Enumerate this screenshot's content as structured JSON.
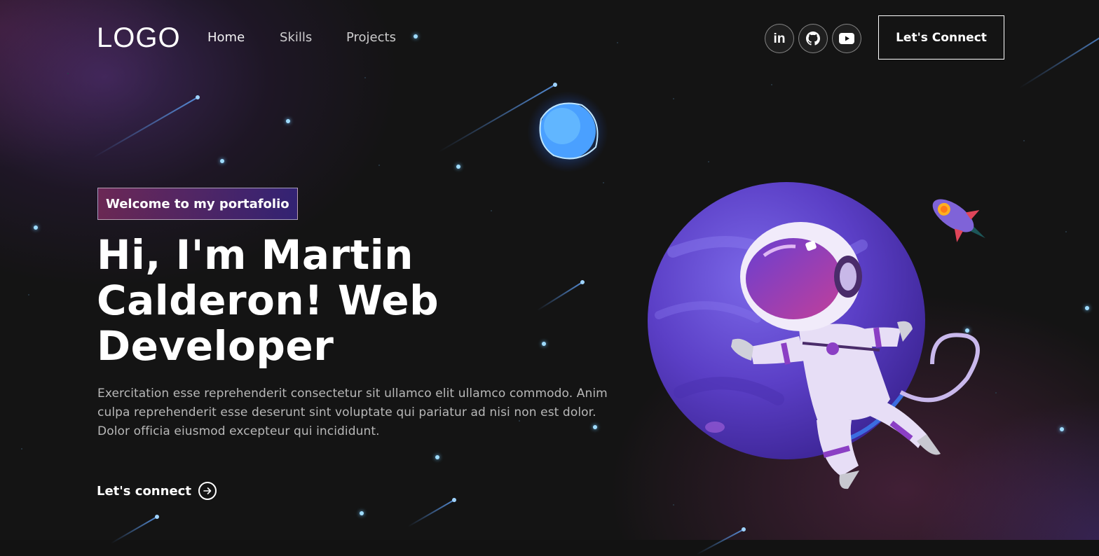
{
  "nav": {
    "logo": "LOGO",
    "links": [
      {
        "label": "Home"
      },
      {
        "label": "Skills"
      },
      {
        "label": "Projects"
      }
    ],
    "social": [
      {
        "icon": "linkedin-icon",
        "glyph": "in"
      },
      {
        "icon": "github-icon"
      },
      {
        "icon": "youtube-icon"
      }
    ],
    "connect_label": "Let's Connect"
  },
  "hero": {
    "tagline": "Welcome to my portafolio",
    "headline": "Hi, I'm Martin Calderon! Web Developer",
    "description": "Exercitation esse reprehenderit consectetur sit ullamco elit ullamco commodo. Anim culpa reprehenderit esse deserunt sint voluptate qui pariatur ad nisi non est dolor. Dolor officia eiusmod excepteur qui incididunt.",
    "cta_label": "Let's connect"
  },
  "colors": {
    "background": "#121212",
    "tag_gradient_start": "#aa367c",
    "tag_gradient_end": "#4a2fbd",
    "planet": "#6a4cd8",
    "star": "#9fdcff"
  }
}
